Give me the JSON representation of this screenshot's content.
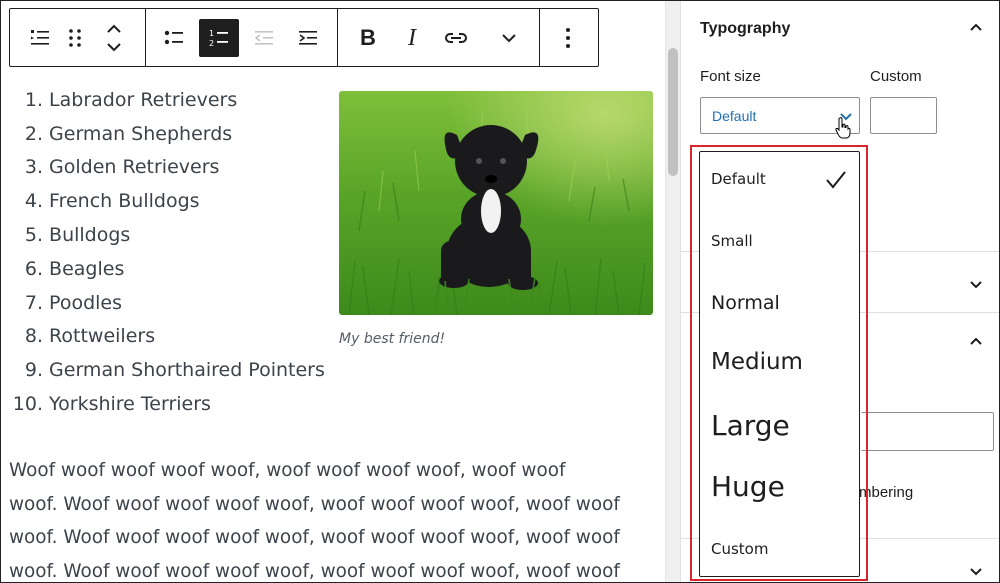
{
  "toolbar": {
    "buttons": [
      "list-view",
      "drag",
      "move",
      "unordered-list",
      "ordered-list",
      "outdent",
      "indent",
      "bold",
      "italic",
      "link",
      "more-formatting",
      "options"
    ],
    "bold_label": "B",
    "italic_label": "I",
    "active": "ordered-list"
  },
  "list": {
    "items": [
      {
        "num": "1.",
        "text": "Labrador Retrievers"
      },
      {
        "num": "2.",
        "text": "German Shepherds"
      },
      {
        "num": "3.",
        "text": "Golden Retrievers"
      },
      {
        "num": "4.",
        "text": "French Bulldogs"
      },
      {
        "num": "5.",
        "text": "Bulldogs"
      },
      {
        "num": "6.",
        "text": "Beagles"
      },
      {
        "num": "7.",
        "text": "Poodles"
      },
      {
        "num": "8.",
        "text": "Rottweilers"
      },
      {
        "num": "9.",
        "text": "German Shorthaired Pointers"
      },
      {
        "num": "10.",
        "text": "Yorkshire Terriers"
      }
    ]
  },
  "image": {
    "caption": "My best friend!"
  },
  "paragraph": {
    "lines": [
      "Woof woof woof woof woof, woof woof woof woof, woof woof",
      "woof. Woof woof woof woof woof, woof woof woof woof, woof woof",
      "woof. Woof woof woof woof woof, woof woof woof woof, woof woof",
      "woof. Woof woof woof woof woof, woof woof woof woof, woof woof"
    ]
  },
  "sidebar": {
    "typography_title": "Typography",
    "font_size_label": "Font size",
    "custom_label": "Custom",
    "select_value": "Default",
    "custom_value": "",
    "partial_text": "mbering"
  },
  "font_size_dropdown": {
    "options": [
      {
        "label": "Default",
        "selected": true
      },
      {
        "label": "Small",
        "selected": false
      },
      {
        "label": "Normal",
        "selected": false
      },
      {
        "label": "Medium",
        "selected": false
      },
      {
        "label": "Large",
        "selected": false
      },
      {
        "label": "Huge",
        "selected": false
      },
      {
        "label": "Custom",
        "selected": false
      }
    ]
  },
  "colors": {
    "accent": "#2271b1",
    "highlight_border": "#d9262c",
    "text": "#3c434a",
    "toolbar_active": "#1e1e1e"
  }
}
